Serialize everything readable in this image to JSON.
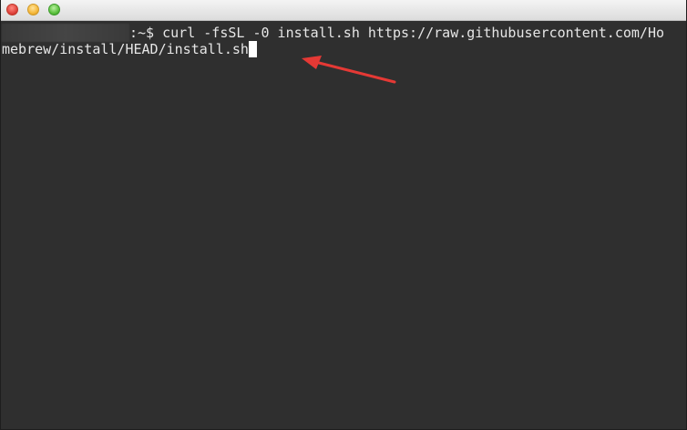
{
  "window": {
    "buttons": [
      "close",
      "minimize",
      "maximize"
    ]
  },
  "terminal": {
    "prompt_suffix": ":~$ ",
    "command_line1": "curl -fsSL -0 install.sh https://raw.githubusercontent.com/Ho",
    "command_line2": "mebrew/install/HEAD/install.sh"
  },
  "annotation": {
    "type": "arrow",
    "color": "#e53935"
  },
  "colors": {
    "terminal_bg": "#2f2f2f",
    "text": "#e6e6e6",
    "titlebar": "#e6e6e6"
  }
}
